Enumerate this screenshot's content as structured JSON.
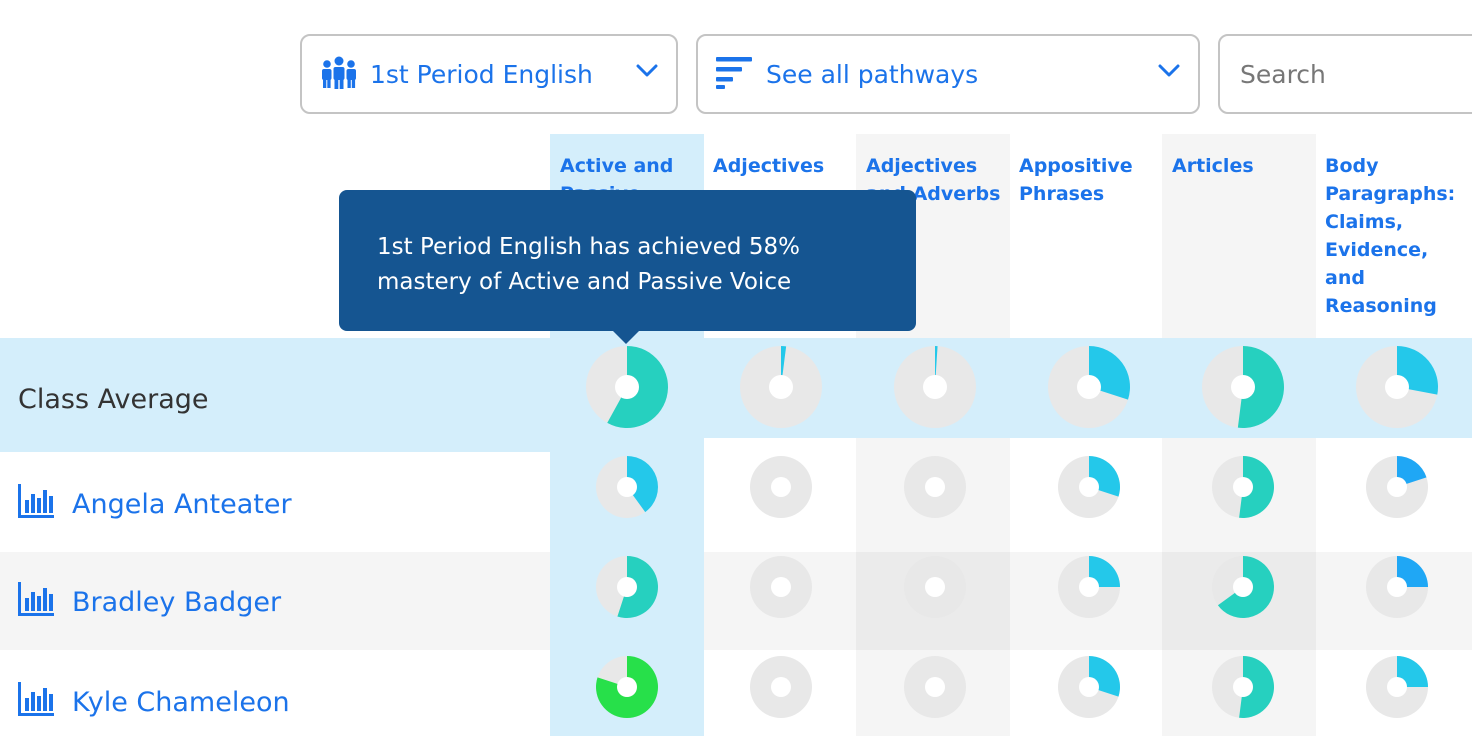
{
  "filters": {
    "class_label": "1st Period English",
    "class_icon": "people-group-icon",
    "pathway_label": "See all pathways",
    "pathway_icon": "filter-lines-icon",
    "search_placeholder": "Search"
  },
  "colors": {
    "accent": "#1b73ea",
    "class_avg_row": "#d4eefb",
    "active_column": "#d4eefb",
    "alt_column": "#f5f5f5",
    "pie_empty": "#e8e8e8",
    "mastery_teal": "#26d0bf",
    "mastery_cyan": "#24c8ea",
    "mastery_blue": "#1fa7f5",
    "mastery_green": "#27e04a",
    "tooltip_bg": "#155591"
  },
  "columns": [
    {
      "label": "Active and Passive Voice",
      "highlight": "active"
    },
    {
      "label": "Adjectives",
      "highlight": "none"
    },
    {
      "label": "Adjectives and Adverbs",
      "highlight": "alt"
    },
    {
      "label": "Appositive Phrases",
      "highlight": "none"
    },
    {
      "label": "Articles",
      "highlight": "alt"
    },
    {
      "label": "Body Paragraphs: Claims, Evidence, and Reasoning",
      "highlight": "none"
    }
  ],
  "class_average": {
    "label": "Class Average",
    "mastery": [
      0.58,
      0.02,
      0.01,
      0.3,
      0.52,
      0.28
    ],
    "colors": [
      "#26d0bf",
      "#24c8ea",
      "#24c8ea",
      "#24c8ea",
      "#26d0bf",
      "#24c8ea"
    ]
  },
  "students": [
    {
      "name": "Angela Anteater",
      "icon": "bar-chart-icon",
      "mastery": [
        0.4,
        0,
        0,
        0.3,
        0.52,
        0.2
      ],
      "colors": [
        "#24c8ea",
        "#e8e8e8",
        "#e8e8e8",
        "#24c8ea",
        "#26d0bf",
        "#1fa7f5"
      ]
    },
    {
      "name": "Bradley Badger",
      "icon": "bar-chart-icon",
      "mastery": [
        0.55,
        0,
        0,
        0.25,
        0.65,
        0.25
      ],
      "colors": [
        "#26d0bf",
        "#e8e8e8",
        "#e8e8e8",
        "#24c8ea",
        "#26d0bf",
        "#1fa7f5"
      ]
    },
    {
      "name": "Kyle Chameleon",
      "icon": "bar-chart-icon",
      "mastery": [
        0.8,
        0,
        0,
        0.3,
        0.52,
        0.25
      ],
      "colors": [
        "#27e04a",
        "#e8e8e8",
        "#e8e8e8",
        "#24c8ea",
        "#26d0bf",
        "#24c8ea"
      ]
    }
  ],
  "tooltip": {
    "text": "1st Period English has achieved 58% mastery of Active and Passive Voice"
  }
}
